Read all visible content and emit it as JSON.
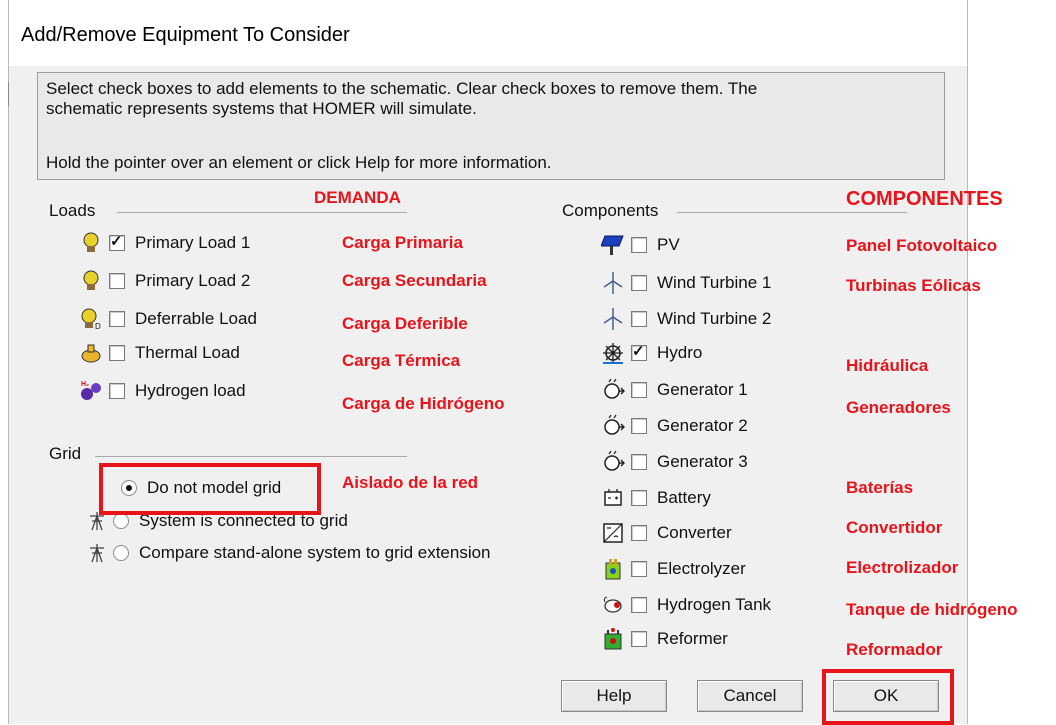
{
  "window": {
    "title": "Add/Remove Equipment To Consider"
  },
  "info": {
    "line1": "Select check boxes to add elements to the schematic. Clear check boxes to remove them. The",
    "line2": "schematic represents systems that HOMER will simulate.",
    "line3": "Hold the pointer over an element or click Help for more information."
  },
  "loads": {
    "label": "Loads",
    "items": [
      {
        "label": "Primary Load 1",
        "checked": true,
        "icon": "primary-load-icon"
      },
      {
        "label": "Primary Load 2",
        "checked": false,
        "icon": "primary-load-icon"
      },
      {
        "label": "Deferrable Load",
        "checked": false,
        "icon": "deferrable-load-icon"
      },
      {
        "label": "Thermal Load",
        "checked": false,
        "icon": "thermal-load-icon"
      },
      {
        "label": "Hydrogen load",
        "checked": false,
        "icon": "hydrogen-load-icon"
      }
    ]
  },
  "grid": {
    "label": "Grid",
    "options": [
      {
        "label": "Do not model grid",
        "selected": true
      },
      {
        "label": "System is connected to grid",
        "selected": false
      },
      {
        "label": "Compare stand-alone system to grid extension",
        "selected": false
      }
    ]
  },
  "components": {
    "label": "Components",
    "items": [
      {
        "label": "PV",
        "checked": false,
        "icon": "pv-panel-icon"
      },
      {
        "label": "Wind Turbine 1",
        "checked": false,
        "icon": "wind-turbine-icon"
      },
      {
        "label": "Wind Turbine 2",
        "checked": false,
        "icon": "wind-turbine-icon"
      },
      {
        "label": "Hydro",
        "checked": true,
        "icon": "hydro-icon"
      },
      {
        "label": "Generator 1",
        "checked": false,
        "icon": "generator-icon"
      },
      {
        "label": "Generator 2",
        "checked": false,
        "icon": "generator-icon"
      },
      {
        "label": "Generator 3",
        "checked": false,
        "icon": "generator-icon"
      },
      {
        "label": "Battery",
        "checked": false,
        "icon": "battery-icon"
      },
      {
        "label": "Converter",
        "checked": false,
        "icon": "converter-icon"
      },
      {
        "label": "Electrolyzer",
        "checked": false,
        "icon": "electrolyzer-icon"
      },
      {
        "label": "Hydrogen Tank",
        "checked": false,
        "icon": "hydrogen-tank-icon"
      },
      {
        "label": "Reformer",
        "checked": false,
        "icon": "reformer-icon"
      }
    ]
  },
  "buttons": {
    "help": "Help",
    "cancel": "Cancel",
    "ok": "OK"
  },
  "annotations": {
    "demanda": "DEMANDA",
    "componentes": "COMPONENTES",
    "loads": [
      "Carga Primaria",
      "Carga Secundaria",
      "Carga Deferible",
      "Carga Térmica",
      "Carga de Hidrógeno"
    ],
    "grid": "Aislado de la red",
    "components": [
      "Panel Fotovoltaico",
      "Turbinas Eólicas",
      "Hidráulica",
      "Generadores",
      "Baterías",
      "Convertidor",
      "Electrolizador",
      "Tanque de hidrógeno",
      "Reformador"
    ]
  },
  "colors": {
    "annotation_red": "#e8141b",
    "dialog_bg": "#f0f0f0"
  }
}
